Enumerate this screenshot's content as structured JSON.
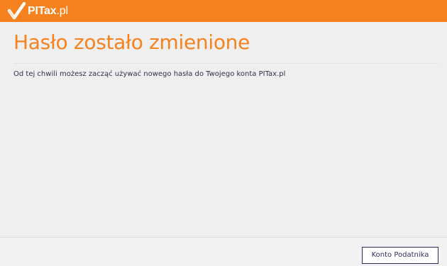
{
  "header": {
    "logo": {
      "brand_bold": "PITax",
      "brand_light": ".pl",
      "icon": "checkmark-logo-icon"
    }
  },
  "main": {
    "title": "Hasło zostało zmienione",
    "message": "Od tej chwili możesz zacząć używać nowego hasła do Twojego konta PITax.pl"
  },
  "footer": {
    "account_button_label": "Konto Podatnika"
  },
  "colors": {
    "brand_orange": "#f5821f",
    "text_dark": "#2f2f4f",
    "button_border": "#2e2e5e",
    "background": "#efefef"
  }
}
